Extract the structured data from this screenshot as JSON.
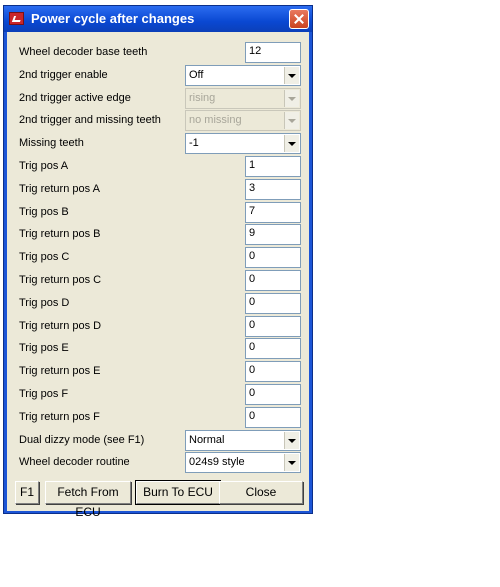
{
  "window": {
    "title": "Power cycle after changes"
  },
  "fields": [
    {
      "label": "Wheel decoder base teeth",
      "type": "text",
      "value": "12"
    },
    {
      "label": "2nd trigger enable",
      "type": "select",
      "value": "Off"
    },
    {
      "label": "2nd trigger active edge",
      "type": "select",
      "value": "rising",
      "disabled": true
    },
    {
      "label": "2nd trigger and missing teeth",
      "type": "select",
      "value": "no missing",
      "disabled": true
    },
    {
      "label": "Missing teeth",
      "type": "select",
      "value": "-1"
    },
    {
      "label": "Trig pos A",
      "type": "text",
      "value": "1"
    },
    {
      "label": "Trig return pos A",
      "type": "text",
      "value": "3"
    },
    {
      "label": "Trig pos B",
      "type": "text",
      "value": "7"
    },
    {
      "label": "Trig return pos B",
      "type": "text",
      "value": "9"
    },
    {
      "label": "Trig pos C",
      "type": "text",
      "value": "0"
    },
    {
      "label": "Trig return pos C",
      "type": "text",
      "value": "0"
    },
    {
      "label": "Trig pos D",
      "type": "text",
      "value": "0"
    },
    {
      "label": "Trig return pos D",
      "type": "text",
      "value": "0"
    },
    {
      "label": "Trig pos E",
      "type": "text",
      "value": "0"
    },
    {
      "label": "Trig return pos E",
      "type": "text",
      "value": "0"
    },
    {
      "label": "Trig pos F",
      "type": "text",
      "value": "0"
    },
    {
      "label": "Trig return pos F",
      "type": "text",
      "value": "0"
    },
    {
      "label": "Dual dizzy mode (see F1)",
      "type": "select",
      "value": "Normal"
    },
    {
      "label": "Wheel decoder routine",
      "type": "select",
      "value": "024s9 style"
    }
  ],
  "buttons": {
    "help": "F1",
    "fetch": "Fetch From ECU",
    "burn": "Burn To ECU",
    "close": "Close"
  },
  "icons": {
    "app": "app-logo-icon",
    "close": "close-icon",
    "dropdown": "chevron-down-icon"
  },
  "colors": {
    "titlebar": "#0a48d2",
    "dialog_bg": "#ece9d8",
    "close_button": "#c9421f"
  }
}
